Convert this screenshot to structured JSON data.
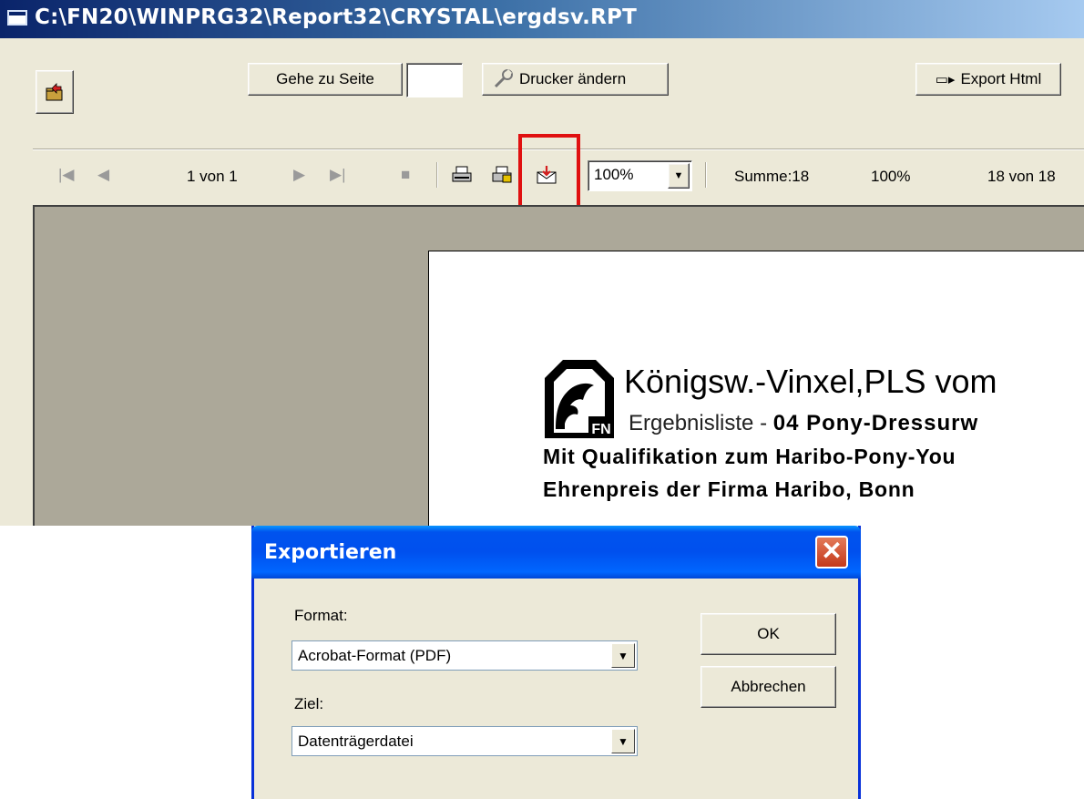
{
  "window": {
    "title": "C:\\FN20\\WINPRG32\\Report32\\CRYSTAL\\ergdsv.RPT"
  },
  "toolbar": {
    "exit_icon": "folder-exit-icon",
    "goto_page_label": "Gehe zu Seite",
    "goto_page_value": "",
    "change_printer_label": "Drucker ändern",
    "export_html_label": "Export Html"
  },
  "viewer": {
    "page_indicator": "1 von 1",
    "zoom": "100%",
    "total_label": "Summe:18",
    "percent_label": "100%",
    "records_label": "18 von 18",
    "highlight_color": "#e01010"
  },
  "report": {
    "title": "Königsw.-Vinxel,PLS vom",
    "subtitle_prefix": "Ergebnisliste -",
    "subtitle_bold": "04 Pony-Dressurw",
    "line1": "Mit Qualifikation zum Haribo-Pony-You",
    "line2": "Ehrenpreis der Firma Haribo, Bonn",
    "logo_text": "FN"
  },
  "dialog": {
    "title": "Exportieren",
    "format_label": "Format:",
    "format_value": "Acrobat-Format (PDF)",
    "target_label": "Ziel:",
    "target_value": "Datenträgerdatei",
    "ok_label": "OK",
    "cancel_label": "Abbrechen"
  }
}
